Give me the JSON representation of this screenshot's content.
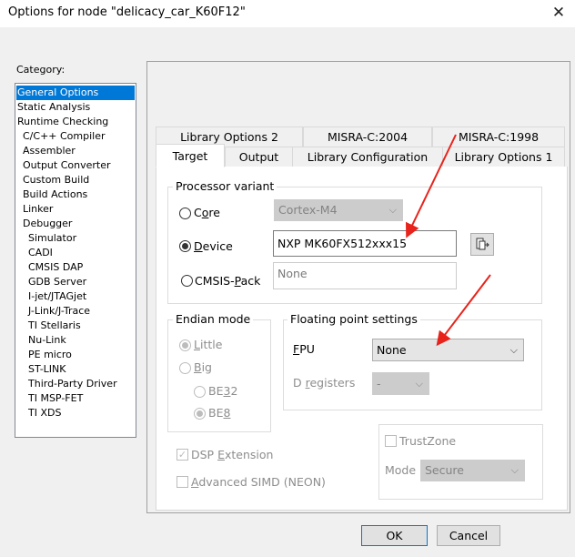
{
  "window": {
    "title": "Options for node \"delicacy_car_K60F12\"",
    "close_glyph": "✕"
  },
  "category": {
    "label": "Category:",
    "items": [
      "General Options",
      "Static Analysis",
      "Runtime Checking",
      "C/C++ Compiler",
      "Assembler",
      "Output Converter",
      "Custom Build",
      "Build Actions",
      "Linker",
      "Debugger",
      "Simulator",
      "CADI",
      "CMSIS DAP",
      "GDB Server",
      "I-jet/JTAGjet",
      "J-Link/J-Trace",
      "TI Stellaris",
      "Nu-Link",
      "PE micro",
      "ST-LINK",
      "Third-Party Driver",
      "TI MSP-FET",
      "TI XDS"
    ],
    "selected": "General Options"
  },
  "tabs": {
    "row_back": [
      "Library Options 2",
      "MISRA-C:2004",
      "MISRA-C:1998"
    ],
    "row_front": [
      "Target",
      "Output",
      "Library Configuration",
      "Library Options 1"
    ],
    "selected": "Target"
  },
  "processor": {
    "group_label": "Processor variant",
    "core_label_a": "C",
    "core_label_u": "o",
    "core_label_b": "re",
    "core_value": "Cortex-M4",
    "device_label_a": "",
    "device_label_u": "D",
    "device_label_b": "evice",
    "device_value": "NXP MK60FX512xxx15",
    "cmsis_label_a": "CMSIS-",
    "cmsis_label_u": "P",
    "cmsis_label_b": "ack",
    "cmsis_value": "None",
    "selected": "Device",
    "device_button_icon": "select-device-icon"
  },
  "endian": {
    "group_label": "Endian mode",
    "little_u": "L",
    "little_b": "ittle",
    "big_u": "B",
    "big_b": "ig",
    "be32_a": "BE",
    "be32_u": "3",
    "be32_b": "2",
    "be8_a": "BE",
    "be8_u": "8",
    "selected": "Little",
    "be_selected": "BE8"
  },
  "floating_point": {
    "group_label": "Floating point settings",
    "fpu_u": "F",
    "fpu_b": "PU",
    "fpu_value": "None",
    "dreg_a": "D ",
    "dreg_u": "r",
    "dreg_b": "egisters",
    "dreg_value": "-"
  },
  "dsp": {
    "a": "DSP ",
    "u": "E",
    "b": "xtension",
    "checked": true,
    "mark": "✓"
  },
  "simd": {
    "u": "A",
    "b": "dvanced SIMD (NEON)",
    "checked": false
  },
  "trustzone": {
    "label": "TrustZone",
    "checked": false,
    "mode_label": "Mode",
    "mode_value": "Secure"
  },
  "buttons": {
    "ok": "OK",
    "cancel": "Cancel"
  },
  "colors": {
    "selection": "#0078d7",
    "annotation_arrow": "#e8231b"
  }
}
